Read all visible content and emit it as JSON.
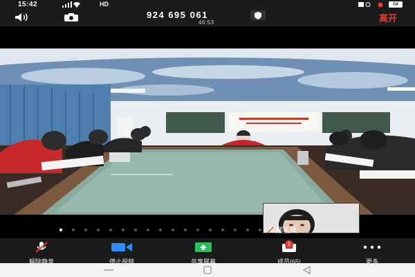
{
  "status_bar": {
    "time": "15:42",
    "network": "HD",
    "battery": "64"
  },
  "meeting": {
    "meeting_id": "924 695 061",
    "timer": "46:53",
    "leave_label": "离开"
  },
  "video": {
    "pagination": {
      "total": 20,
      "active_index": 0
    }
  },
  "self_view": {
    "name": "邢礼凤"
  },
  "toolbar": {
    "unmute_label": "解除静音",
    "stop_video_label": "停止视频",
    "share_screen_label": "共享屏幕",
    "participants_label": "成员(65)",
    "participants_badge": "1",
    "more_label": "更多"
  },
  "colors": {
    "leave_red": "#e23b2c",
    "toolbar_bg": "#1b1b1b",
    "video_icon_blue": "#2d8cff",
    "share_green": "#27c05a"
  },
  "icons": [
    "speaker-icon",
    "camera-switch-icon",
    "shield-icon",
    "microphone-muted-icon",
    "video-camera-icon",
    "share-screen-icon",
    "participants-icon",
    "more-icon",
    "back-nav-icon",
    "home-nav-icon",
    "recent-nav-icon"
  ]
}
